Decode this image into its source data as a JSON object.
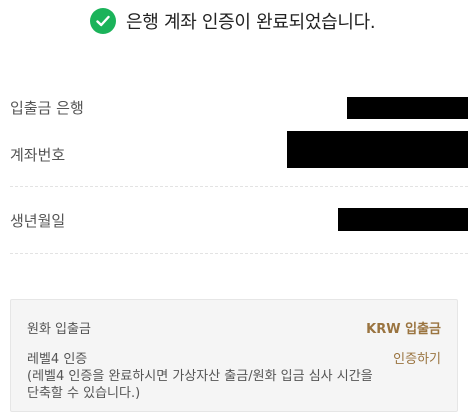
{
  "banner": {
    "icon": "check-circle-icon",
    "color": "#1bb35a",
    "message": "은행 계좌 인증이 완료되었습니다."
  },
  "account_info": {
    "bank_label": "입출금 은행",
    "account_number_label": "계좌번호",
    "birth_date_label": "생년월일"
  },
  "info_box": {
    "krw_label": "원화 입출금",
    "krw_link": "KRW 입출금",
    "level_label": "레벨4 인증",
    "level_link": "인증하기",
    "note": "(레벨4 인증을 완료하시면 가상자산 출금/원화 입금 심사 시간을 단축할 수 있습니다.)",
    "link_color": "#9a7440"
  }
}
